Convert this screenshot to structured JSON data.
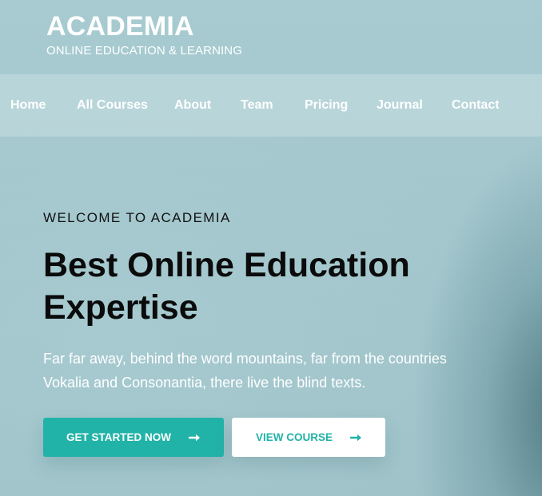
{
  "brand": {
    "title": "ACADEMIA",
    "subtitle": "ONLINE EDUCATION & LEARNING"
  },
  "nav": {
    "items": [
      {
        "label": "Home"
      },
      {
        "label": "All Courses"
      },
      {
        "label": "About"
      },
      {
        "label": "Team"
      },
      {
        "label": "Pricing"
      },
      {
        "label": "Journal"
      },
      {
        "label": "Contact"
      }
    ]
  },
  "hero": {
    "eyebrow": "WELCOME TO ACADEMIA",
    "title": "Best Online Education Expertise",
    "text": "Far far away, behind the word mountains, far from the countries Vokalia and Consonantia, there live the blind texts."
  },
  "buttons": {
    "primary": {
      "label": "GET STARTED NOW",
      "icon": "arrow-right-icon"
    },
    "secondary": {
      "label": "VIEW COURSE",
      "icon": "arrow-right-icon"
    }
  },
  "colors": {
    "accent": "#22b3a8",
    "nav_text": "#ffffff",
    "heading_text": "#0b0b0b"
  }
}
